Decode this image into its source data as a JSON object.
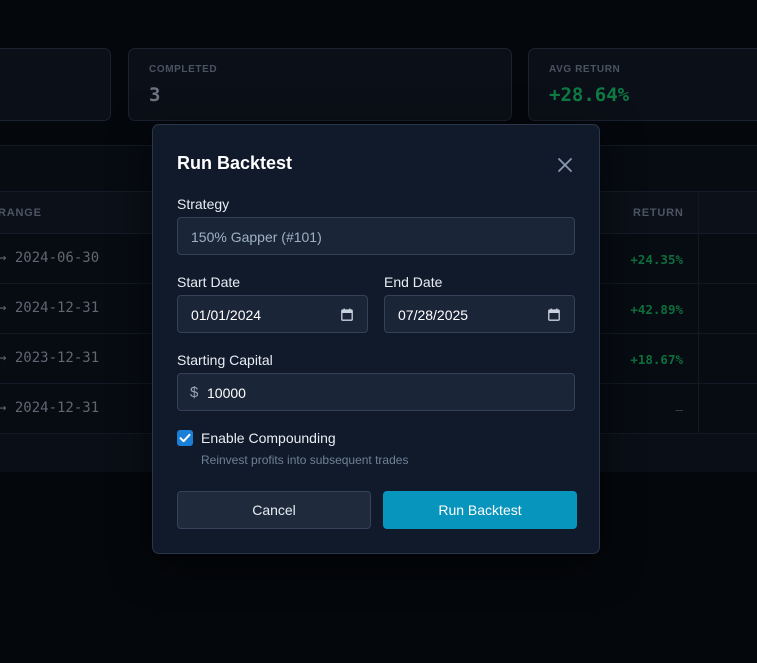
{
  "dashboard": {
    "stats": [
      {
        "label": "",
        "value": ""
      },
      {
        "label": "COMPLETED",
        "value": "3"
      },
      {
        "label": "AVG RETURN",
        "value": "+28.64%"
      }
    ],
    "table": {
      "headers": {
        "range": "RANGE",
        "return": "RETURN"
      },
      "rows": [
        {
          "range_end": "→ 2024-06-30",
          "return": "+24.35%"
        },
        {
          "range_end": "→ 2024-12-31",
          "return": "+42.89%"
        },
        {
          "range_end": "→ 2023-12-31",
          "return": "+18.67%"
        },
        {
          "range_end": "→ 2024-12-31",
          "return": "—"
        }
      ]
    }
  },
  "modal": {
    "title": "Run Backtest",
    "strategy": {
      "label": "Strategy",
      "value": "150% Gapper (#101)"
    },
    "start_date": {
      "label": "Start Date",
      "value": "01/01/2024"
    },
    "end_date": {
      "label": "End Date",
      "value": "07/28/2025"
    },
    "capital": {
      "label": "Starting Capital",
      "currency_symbol": "$",
      "value": "10000"
    },
    "compounding": {
      "label": "Enable Compounding",
      "hint": "Reinvest profits into subsequent trades",
      "checked": true
    },
    "buttons": {
      "cancel": "Cancel",
      "run": "Run Backtest"
    }
  },
  "colors": {
    "accent": "#0794bd",
    "checkbox": "#1a7fd6",
    "positive": "#0e6e3d",
    "modal_bg": "#111a2b"
  },
  "icons": {
    "close": "close-icon",
    "calendar": "calendar-icon",
    "check": "check-icon"
  }
}
